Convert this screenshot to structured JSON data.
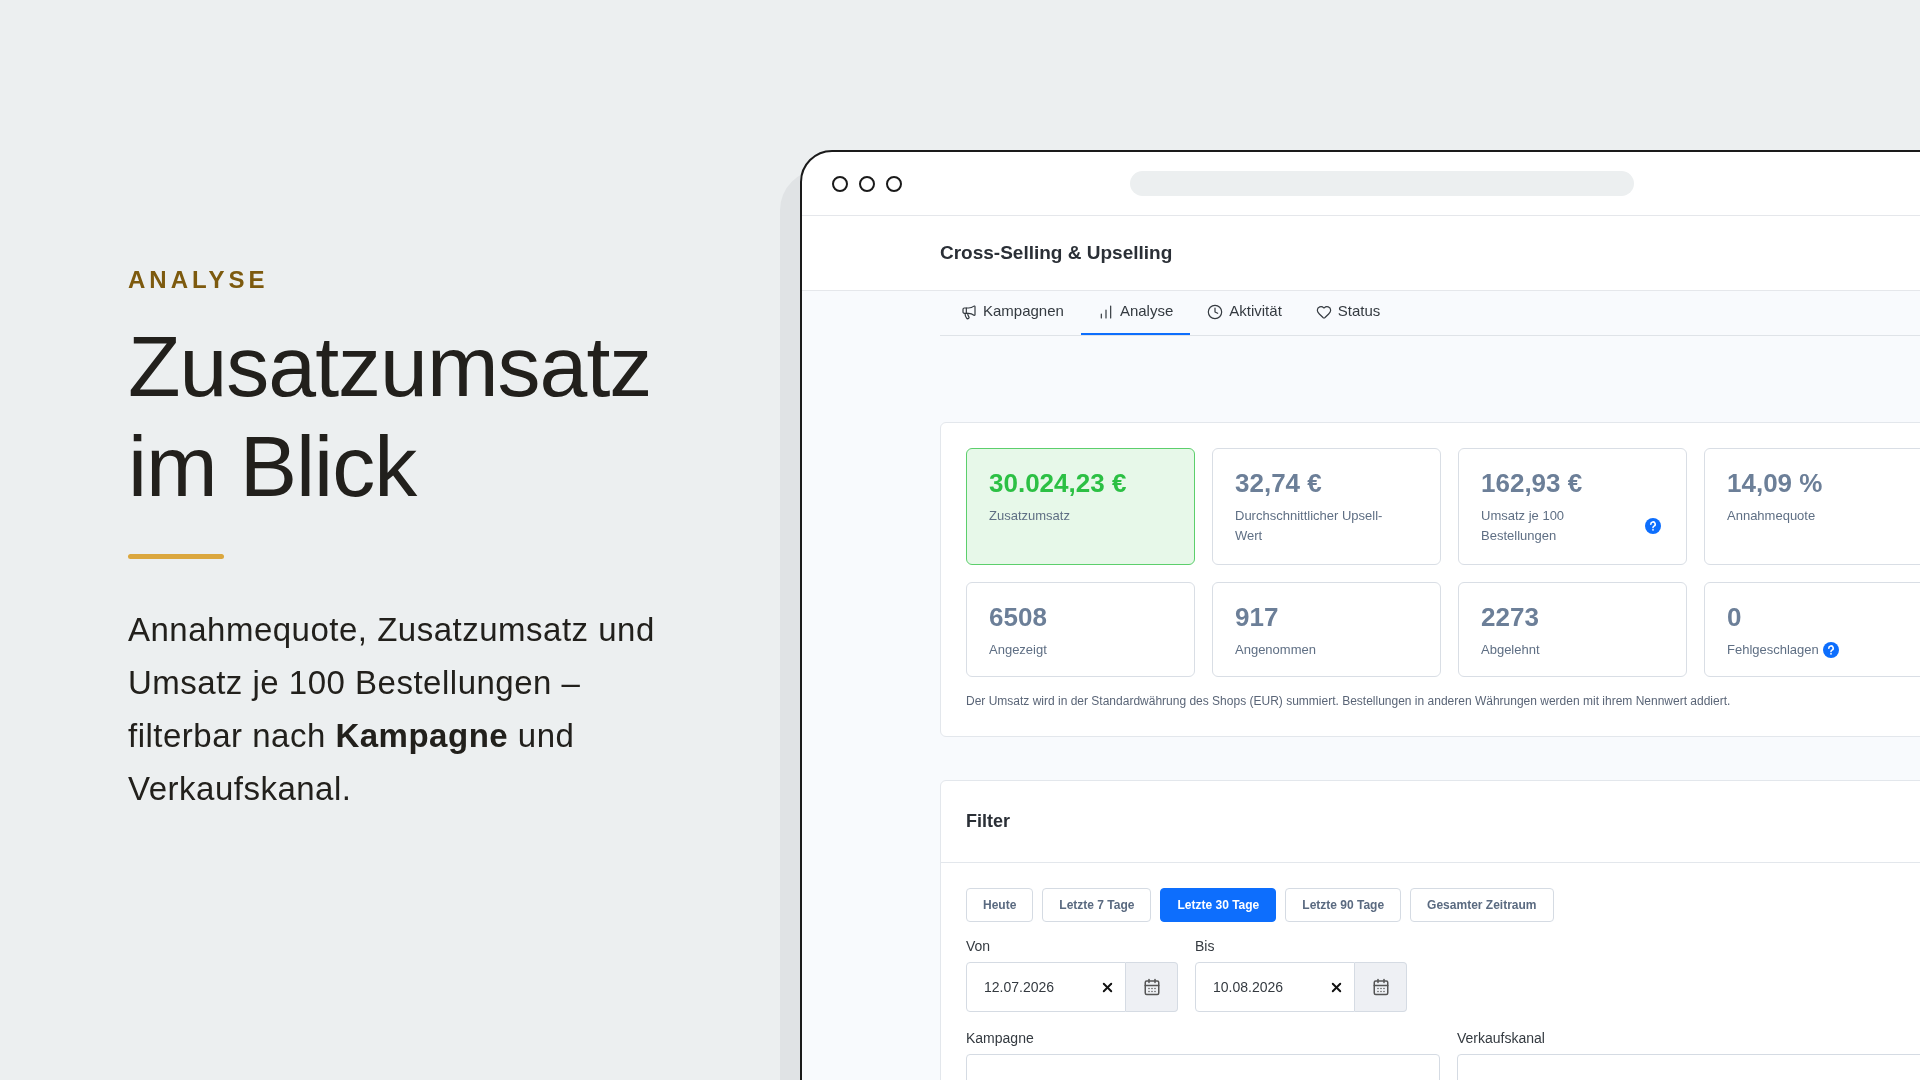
{
  "intro": {
    "eyebrow": "ANALYSE",
    "heading": "Zusatzumsatz im Blick",
    "text": "Annahmequote, Zusatzumsatz und Umsatz je 100 Bestellungen – filterbar nach **Kampagne** und Verkaufskanal."
  },
  "app": {
    "title": "Cross-Selling & Upselling",
    "tabs": [
      {
        "label": "Kampagnen",
        "selected": false
      },
      {
        "label": "Analyse",
        "selected": true
      },
      {
        "label": "Aktivität",
        "selected": false
      },
      {
        "label": "Status",
        "selected": false
      }
    ],
    "stats": [
      {
        "value": "30.024,23 €",
        "label": "Zusatzumsatz",
        "highlighted": true,
        "help": false
      },
      {
        "value": "32,74 €",
        "label": "Durchschnittlicher Upsell-Wert",
        "highlighted": false,
        "help": false
      },
      {
        "value": "162,93 €",
        "label": "Umsatz je 100 Bestellungen",
        "highlighted": false,
        "help": true
      },
      {
        "value": "14,09 %",
        "label": "Annahmequote",
        "highlighted": false,
        "help": false
      },
      {
        "value": "6508",
        "label": "Angezeigt",
        "highlighted": false,
        "help": false
      },
      {
        "value": "917",
        "label": "Angenommen",
        "highlighted": false,
        "help": false
      },
      {
        "value": "2273",
        "label": "Abgelehnt",
        "highlighted": false,
        "help": false
      },
      {
        "value": "0",
        "label": "Fehlgeschlagen",
        "highlighted": false,
        "help": true
      }
    ],
    "note": "Der Umsatz wird in der Standardwährung des Shops (EUR) summiert. Bestellungen in anderen Währungen werden mit ihrem Nennwert addiert.",
    "filter": {
      "title": "Filter",
      "ranges": [
        {
          "label": "Heute",
          "selected": false
        },
        {
          "label": "Letzte 7 Tage",
          "selected": false
        },
        {
          "label": "Letzte 30 Tage",
          "selected": true
        },
        {
          "label": "Letzte 90 Tage",
          "selected": false
        },
        {
          "label": "Gesamter Zeitraum",
          "selected": false
        }
      ],
      "dates": [
        {
          "label": "Von",
          "value": "12.07.2026"
        },
        {
          "label": "Bis",
          "value": "10.08.2026"
        }
      ],
      "selects": [
        {
          "label": "Kampagne"
        },
        {
          "label": "Verkaufskanal"
        }
      ]
    }
  }
}
